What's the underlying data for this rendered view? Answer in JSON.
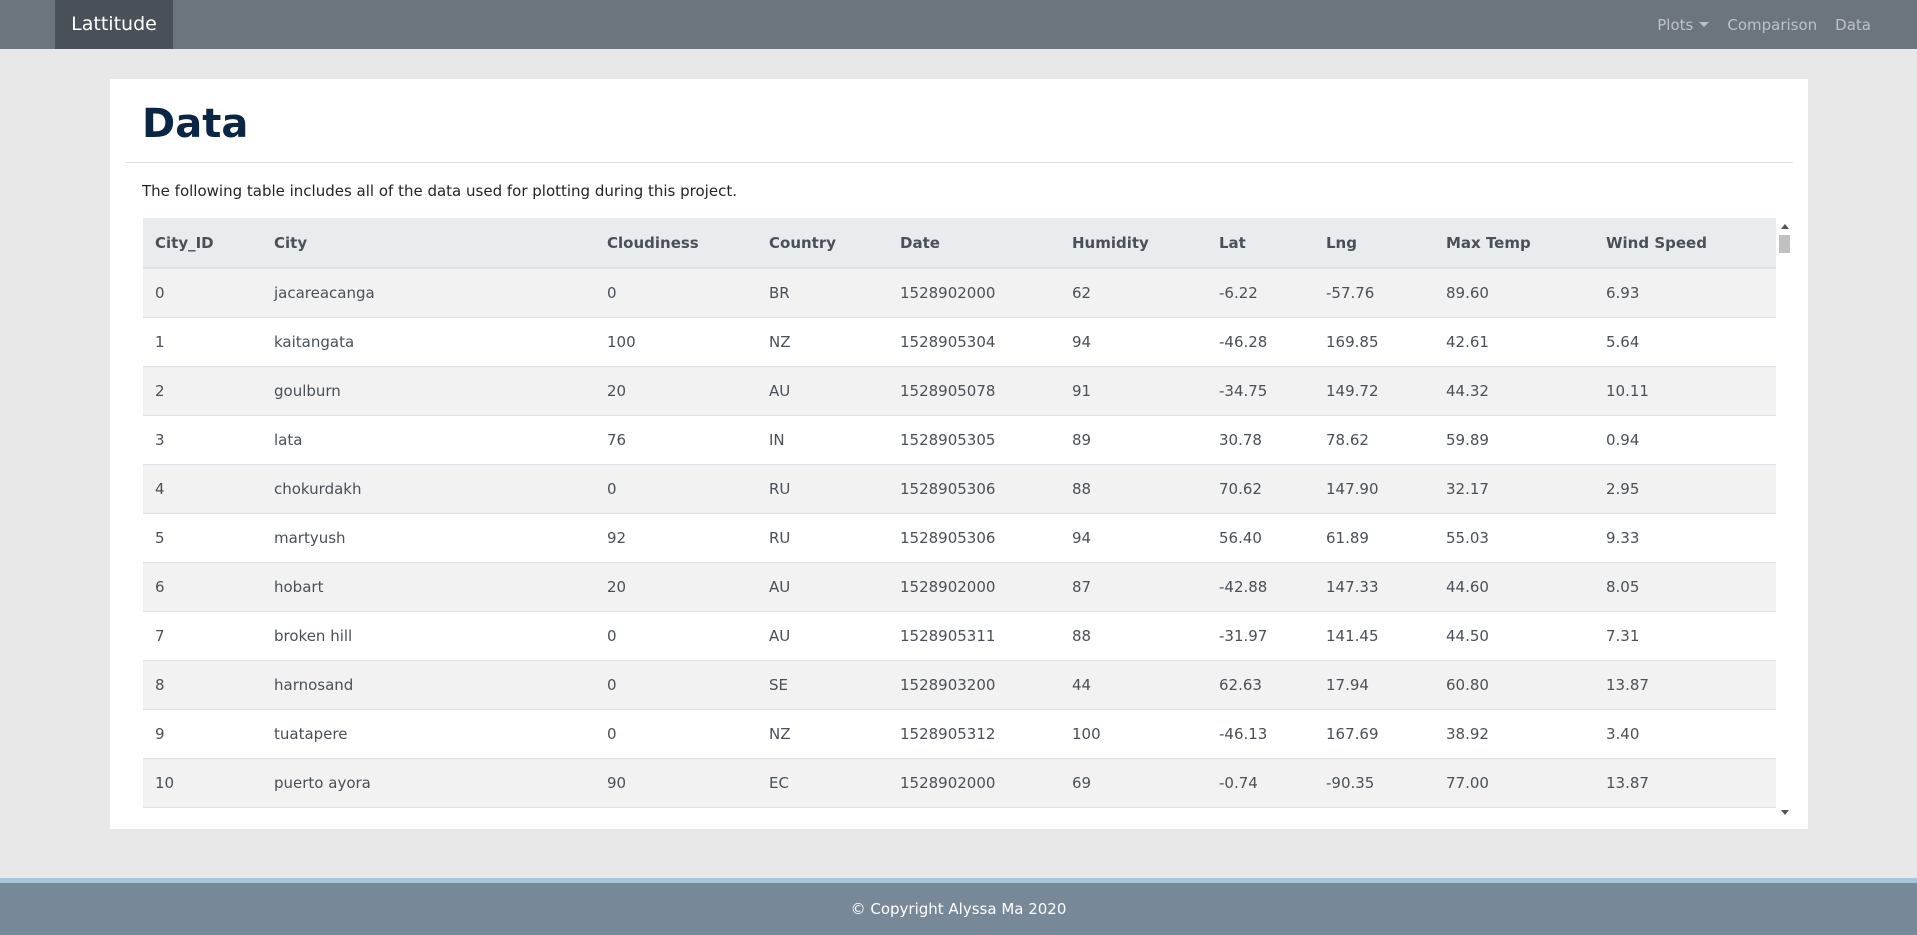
{
  "navbar": {
    "brand": "Lattitude",
    "links": [
      {
        "label": "Plots",
        "dropdown": true
      },
      {
        "label": "Comparison"
      },
      {
        "label": "Data"
      }
    ]
  },
  "page": {
    "title": "Data",
    "intro": "The following table includes all of the data used for plotting during this project."
  },
  "table": {
    "columns": [
      "City_ID",
      "City",
      "Cloudiness",
      "Country",
      "Date",
      "Humidity",
      "Lat",
      "Lng",
      "Max Temp",
      "Wind Speed"
    ],
    "rows": [
      [
        "0",
        "jacareacanga",
        "0",
        "BR",
        "1528902000",
        "62",
        "-6.22",
        "-57.76",
        "89.60",
        "6.93"
      ],
      [
        "1",
        "kaitangata",
        "100",
        "NZ",
        "1528905304",
        "94",
        "-46.28",
        "169.85",
        "42.61",
        "5.64"
      ],
      [
        "2",
        "goulburn",
        "20",
        "AU",
        "1528905078",
        "91",
        "-34.75",
        "149.72",
        "44.32",
        "10.11"
      ],
      [
        "3",
        "lata",
        "76",
        "IN",
        "1528905305",
        "89",
        "30.78",
        "78.62",
        "59.89",
        "0.94"
      ],
      [
        "4",
        "chokurdakh",
        "0",
        "RU",
        "1528905306",
        "88",
        "70.62",
        "147.90",
        "32.17",
        "2.95"
      ],
      [
        "5",
        "martyush",
        "92",
        "RU",
        "1528905306",
        "94",
        "56.40",
        "61.89",
        "55.03",
        "9.33"
      ],
      [
        "6",
        "hobart",
        "20",
        "AU",
        "1528902000",
        "87",
        "-42.88",
        "147.33",
        "44.60",
        "8.05"
      ],
      [
        "7",
        "broken hill",
        "0",
        "AU",
        "1528905311",
        "88",
        "-31.97",
        "141.45",
        "44.50",
        "7.31"
      ],
      [
        "8",
        "harnosand",
        "0",
        "SE",
        "1528903200",
        "44",
        "62.63",
        "17.94",
        "60.80",
        "13.87"
      ],
      [
        "9",
        "tuatapere",
        "0",
        "NZ",
        "1528905312",
        "100",
        "-46.13",
        "167.69",
        "38.92",
        "3.40"
      ],
      [
        "10",
        "puerto ayora",
        "90",
        "EC",
        "1528902000",
        "69",
        "-0.74",
        "-90.35",
        "77.00",
        "13.87"
      ]
    ]
  },
  "footer": {
    "text": "© Copyright Alyssa Ma 2020"
  }
}
